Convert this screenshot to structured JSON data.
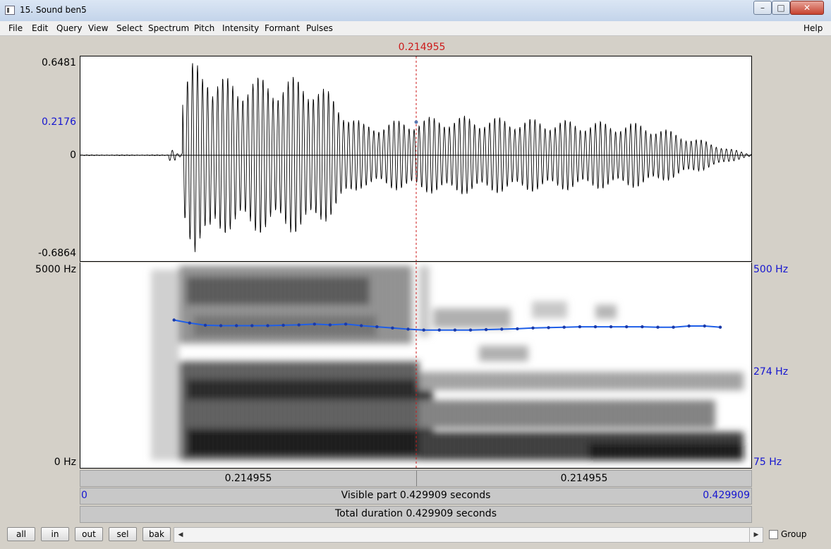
{
  "window": {
    "title": "15. Sound ben5"
  },
  "menus": [
    "File",
    "Edit",
    "Query",
    "View",
    "Select",
    "Spectrum",
    "Pitch",
    "Intensity",
    "Formant",
    "Pulses"
  ],
  "help": "Help",
  "cursor_time": "0.214955",
  "waveform": {
    "y_max": "0.6481",
    "y_cursor": "0.2176",
    "y_zero": "0",
    "y_min": "-0.6864"
  },
  "spectrogram": {
    "freq_top": "5000 Hz",
    "freq_bottom": "0 Hz"
  },
  "pitch_axis": {
    "top": "500 Hz",
    "mid": "274 Hz",
    "bottom": "75 Hz"
  },
  "selection_bar": {
    "left": "0.214955",
    "right": "0.214955"
  },
  "visible_bar": {
    "start": "0",
    "text": "Visible part 0.429909 seconds",
    "end": "0.429909"
  },
  "total_bar": {
    "text": "Total duration 0.429909 seconds"
  },
  "buttons": {
    "all": "all",
    "in": "in",
    "out": "out",
    "sel": "sel",
    "bak": "bak"
  },
  "group_label": "Group",
  "colors": {
    "cursor": "#cc1a1a",
    "axis_blue": "#1515d0",
    "pitch_line": "#1e5ee8"
  },
  "chart_data": {
    "type": "line",
    "title": "",
    "xlabel": "",
    "ylabel": "",
    "x_range": [
      0,
      0.429909
    ],
    "ylim": [
      75,
      500
    ],
    "series": [
      {
        "x": [
          0.06,
          0.07,
          0.08,
          0.09,
          0.1,
          0.11,
          0.12,
          0.13,
          0.14,
          0.15,
          0.16,
          0.17,
          0.18,
          0.19,
          0.2,
          0.21,
          0.22,
          0.23,
          0.24,
          0.25,
          0.26,
          0.27,
          0.28,
          0.29,
          0.3,
          0.31,
          0.32,
          0.33,
          0.34,
          0.35,
          0.36,
          0.37,
          0.38,
          0.39,
          0.4,
          0.41
        ],
        "values": [
          294,
          286,
          280,
          279,
          279,
          279,
          279,
          280,
          281,
          283,
          281,
          283,
          279,
          276,
          273,
          270,
          268,
          268,
          268,
          268,
          269,
          270,
          271,
          273,
          274,
          275,
          276,
          276,
          276,
          276,
          276,
          275,
          275,
          278,
          278,
          275
        ]
      }
    ]
  }
}
